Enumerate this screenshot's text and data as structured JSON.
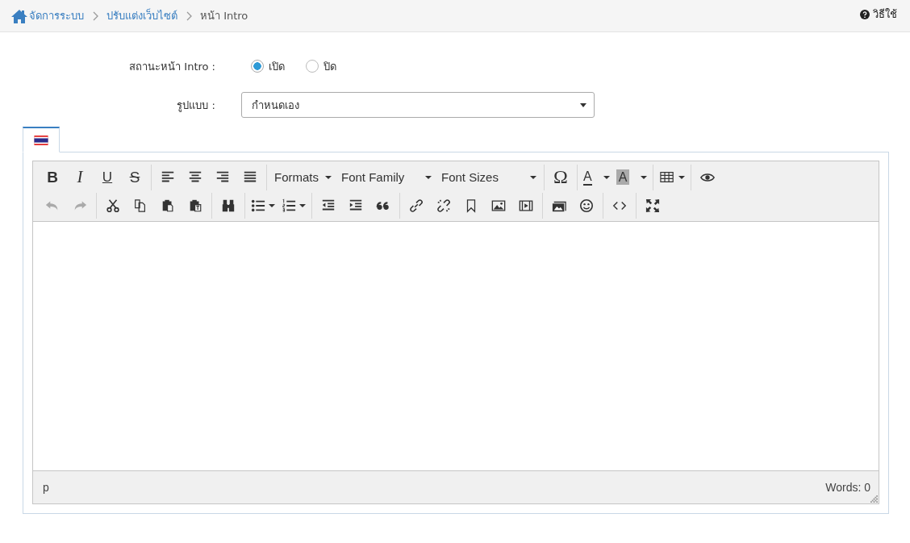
{
  "breadcrumb": {
    "items": [
      {
        "label": "จัดการระบบ",
        "link": true
      },
      {
        "label": "ปรับแต่งเว็บไซต์",
        "link": true
      },
      {
        "label": "หน้า Intro",
        "link": false
      }
    ],
    "help": "วิธีใช้"
  },
  "form": {
    "status": {
      "label": "สถานะหน้า Intro :",
      "options": [
        {
          "label": "เปิด",
          "selected": true
        },
        {
          "label": "ปิด",
          "selected": false
        }
      ]
    },
    "style": {
      "label": "รูปแบบ :",
      "value": "กำหนดเอง"
    }
  },
  "tabs": [
    {
      "selected": true
    }
  ],
  "toolbar": [
    [
      [
        {
          "kind": "bold",
          "text": "B"
        },
        {
          "kind": "italic",
          "text": "I"
        },
        {
          "kind": "underline",
          "text": "U"
        },
        {
          "kind": "strike",
          "text": "S"
        }
      ],
      [
        {
          "kind": "icon"
        },
        {
          "kind": "icon"
        },
        {
          "kind": "icon"
        },
        {
          "kind": "icon"
        }
      ],
      [
        {
          "kind": "menu",
          "text": "Formats"
        },
        {
          "kind": "menu",
          "text": "Font Family"
        },
        {
          "kind": "menu",
          "text": "Font Sizes"
        }
      ],
      [
        {
          "kind": "glyph",
          "text": "Ω"
        }
      ],
      [
        {
          "kind": "textcolor",
          "text": "A",
          "dropdown": true
        },
        {
          "kind": "bgcolor",
          "text": "A",
          "dropdown": true
        }
      ],
      [
        {
          "kind": "icon",
          "dropdown": true
        }
      ],
      [
        {
          "kind": "icon"
        }
      ]
    ],
    [
      [
        {
          "kind": "icon",
          "disabled": true
        },
        {
          "kind": "icon",
          "disabled": true
        }
      ],
      [
        {
          "kind": "icon"
        },
        {
          "kind": "icon"
        },
        {
          "kind": "icon"
        },
        {
          "kind": "icon"
        }
      ],
      [
        {
          "kind": "icon"
        }
      ],
      [
        {
          "kind": "icon",
          "dropdown": true
        },
        {
          "kind": "icon",
          "dropdown": true
        }
      ],
      [
        {
          "kind": "icon"
        },
        {
          "kind": "icon"
        },
        {
          "kind": "icon"
        }
      ],
      [
        {
          "kind": "icon"
        },
        {
          "kind": "icon"
        },
        {
          "kind": "icon"
        },
        {
          "kind": "icon"
        },
        {
          "kind": "icon"
        }
      ],
      [
        {
          "kind": "icon"
        },
        {
          "kind": "icon"
        }
      ],
      [
        {
          "kind": "icon"
        }
      ],
      [
        {
          "kind": "icon"
        }
      ]
    ]
  ],
  "statusbar": {
    "path": "p",
    "words": "Words: 0"
  }
}
